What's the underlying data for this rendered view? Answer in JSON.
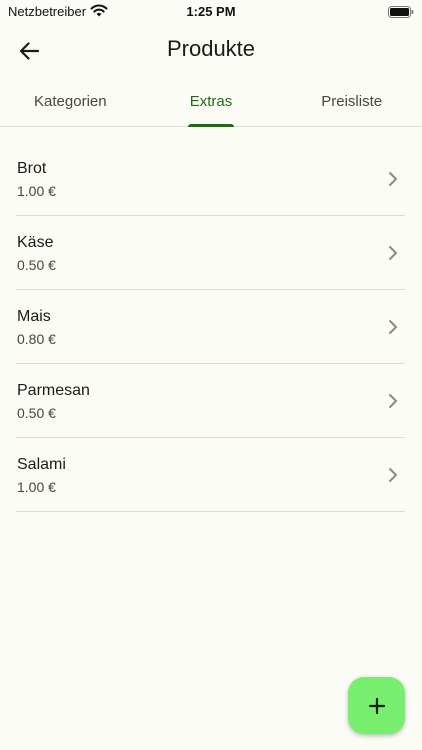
{
  "status_bar": {
    "carrier": "Netzbetreiber",
    "time": "1:25 PM"
  },
  "header": {
    "title": "Produkte"
  },
  "tabs": [
    {
      "label": "Kategorien",
      "active": false
    },
    {
      "label": "Extras",
      "active": true
    },
    {
      "label": "Preisliste",
      "active": false
    }
  ],
  "items": [
    {
      "name": "Brot",
      "price": "1.00 €"
    },
    {
      "name": "Käse",
      "price": "0.50 €"
    },
    {
      "name": "Mais",
      "price": "0.80 €"
    },
    {
      "name": "Parmesan",
      "price": "0.50 €"
    },
    {
      "name": "Salami",
      "price": "1.00 €"
    }
  ],
  "icons": {
    "back": "arrow-left-icon",
    "chevron": "chevron-right-icon",
    "add": "plus-icon",
    "wifi": "wifi-icon",
    "battery": "battery-icon"
  },
  "colors": {
    "accent": "#1f6b12",
    "fab": "#77ee6e",
    "background": "#fcfcf6"
  }
}
